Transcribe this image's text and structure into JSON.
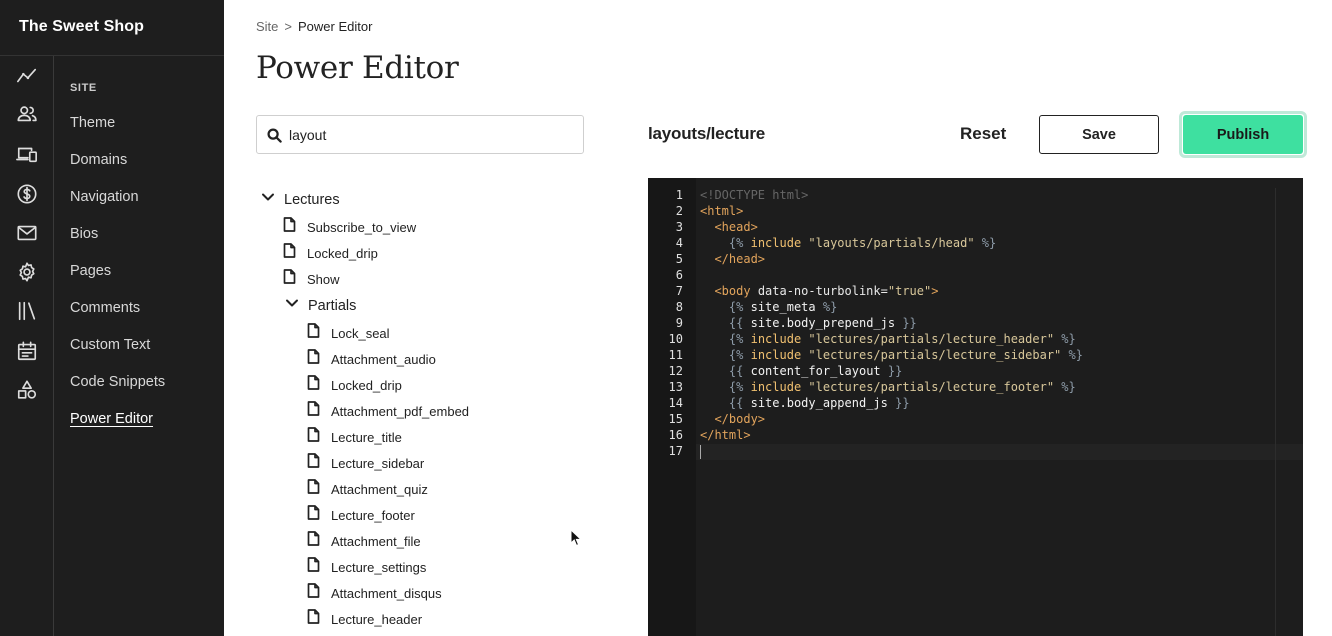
{
  "app": {
    "brand": "The Sweet Shop"
  },
  "rail_icons": [
    {
      "name": "analytics-icon"
    },
    {
      "name": "users-icon"
    },
    {
      "name": "devices-icon"
    },
    {
      "name": "dollar-icon"
    },
    {
      "name": "mail-icon"
    },
    {
      "name": "gear-icon"
    },
    {
      "name": "library-icon"
    },
    {
      "name": "calendar-icon"
    },
    {
      "name": "shapes-icon"
    }
  ],
  "site_nav": {
    "heading": "SITE",
    "items": [
      {
        "label": "Theme"
      },
      {
        "label": "Domains"
      },
      {
        "label": "Navigation"
      },
      {
        "label": "Bios"
      },
      {
        "label": "Pages"
      },
      {
        "label": "Comments"
      },
      {
        "label": "Custom Text"
      },
      {
        "label": "Code Snippets"
      },
      {
        "label": "Power Editor",
        "active": true
      }
    ]
  },
  "breadcrumb": {
    "root": "Site",
    "separator": ">",
    "current": "Power Editor"
  },
  "page_title": "Power Editor",
  "search": {
    "value": "layout",
    "placeholder": ""
  },
  "tree": {
    "folder": "Lectures",
    "files": [
      "Subscribe_to_view",
      "Locked_drip",
      "Show"
    ],
    "subfolder": "Partials",
    "subfiles": [
      "Lock_seal",
      "Attachment_audio",
      "Locked_drip",
      "Attachment_pdf_embed",
      "Lecture_title",
      "Lecture_sidebar",
      "Attachment_quiz",
      "Lecture_footer",
      "Attachment_file",
      "Lecture_settings",
      "Attachment_disqus",
      "Lecture_header"
    ]
  },
  "editor": {
    "file_path": "layouts/lecture",
    "reset_label": "Reset",
    "save_label": "Save",
    "publish_label": "Publish",
    "line_numbers": [
      "1",
      "2",
      "3",
      "4",
      "5",
      "6",
      "7",
      "8",
      "9",
      "10",
      "11",
      "12",
      "13",
      "14",
      "15",
      "16",
      "17"
    ],
    "lines": [
      [
        {
          "t": "doc",
          "v": "<!DOCTYPE html>"
        }
      ],
      [
        {
          "t": "tag",
          "v": "<html>"
        }
      ],
      [
        {
          "t": "sp",
          "v": "  "
        },
        {
          "t": "tag",
          "v": "<head>"
        }
      ],
      [
        {
          "t": "sp",
          "v": "    "
        },
        {
          "t": "liq",
          "v": "{% "
        },
        {
          "t": "kw",
          "v": "include"
        },
        {
          "t": "sp",
          "v": " "
        },
        {
          "t": "str",
          "v": "\"layouts/partials/head\""
        },
        {
          "t": "liq",
          "v": " %}"
        }
      ],
      [
        {
          "t": "sp",
          "v": "  "
        },
        {
          "t": "tag",
          "v": "</head>"
        }
      ],
      [],
      [
        {
          "t": "sp",
          "v": "  "
        },
        {
          "t": "tag",
          "v": "<body"
        },
        {
          "t": "sp",
          "v": " "
        },
        {
          "t": "attr",
          "v": "data-no-turbolink"
        },
        {
          "t": "eq",
          "v": "="
        },
        {
          "t": "str",
          "v": "\"true\""
        },
        {
          "t": "tag",
          "v": ">"
        }
      ],
      [
        {
          "t": "sp",
          "v": "    "
        },
        {
          "t": "liq",
          "v": "{% "
        },
        {
          "t": "var",
          "v": "site_meta"
        },
        {
          "t": "liq",
          "v": " %}"
        }
      ],
      [
        {
          "t": "sp",
          "v": "    "
        },
        {
          "t": "liq",
          "v": "{{ "
        },
        {
          "t": "var",
          "v": "site.body_prepend_js"
        },
        {
          "t": "liq",
          "v": " }}"
        }
      ],
      [
        {
          "t": "sp",
          "v": "    "
        },
        {
          "t": "liq",
          "v": "{% "
        },
        {
          "t": "kw",
          "v": "include"
        },
        {
          "t": "sp",
          "v": " "
        },
        {
          "t": "str",
          "v": "\"lectures/partials/lecture_header\""
        },
        {
          "t": "liq",
          "v": " %}"
        }
      ],
      [
        {
          "t": "sp",
          "v": "    "
        },
        {
          "t": "liq",
          "v": "{% "
        },
        {
          "t": "kw",
          "v": "include"
        },
        {
          "t": "sp",
          "v": " "
        },
        {
          "t": "str",
          "v": "\"lectures/partials/lecture_sidebar\""
        },
        {
          "t": "liq",
          "v": " %}"
        }
      ],
      [
        {
          "t": "sp",
          "v": "    "
        },
        {
          "t": "liq",
          "v": "{{ "
        },
        {
          "t": "var",
          "v": "content_for_layout"
        },
        {
          "t": "liq",
          "v": " }}"
        }
      ],
      [
        {
          "t": "sp",
          "v": "    "
        },
        {
          "t": "liq",
          "v": "{% "
        },
        {
          "t": "kw",
          "v": "include"
        },
        {
          "t": "sp",
          "v": " "
        },
        {
          "t": "str",
          "v": "\"lectures/partials/lecture_footer\""
        },
        {
          "t": "liq",
          "v": " %}"
        }
      ],
      [
        {
          "t": "sp",
          "v": "    "
        },
        {
          "t": "liq",
          "v": "{{ "
        },
        {
          "t": "var",
          "v": "site.body_append_js"
        },
        {
          "t": "liq",
          "v": " }}"
        }
      ],
      [
        {
          "t": "sp",
          "v": "  "
        },
        {
          "t": "tag",
          "v": "</body>"
        }
      ],
      [
        {
          "t": "tag",
          "v": "</html>"
        }
      ],
      []
    ]
  },
  "colors": {
    "sidebar_bg": "#1e1e1e",
    "publish_bg": "#3ee0a0",
    "editor_bg": "#1d1d1d"
  }
}
